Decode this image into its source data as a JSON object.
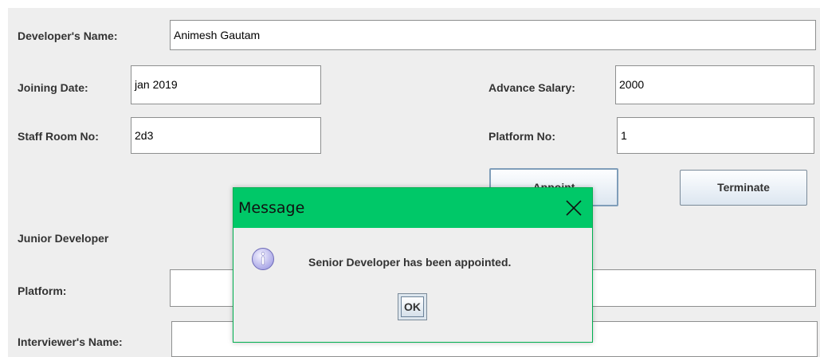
{
  "form": {
    "developer_name_label": "Developer's Name:",
    "developer_name_value": "Animesh Gautam",
    "joining_date_label": "Joining Date:",
    "joining_date_value": "jan 2019",
    "advance_salary_label": "Advance Salary:",
    "advance_salary_value": "2000",
    "staff_room_label": "Staff Room No:",
    "staff_room_value": "2d3",
    "platform_no_label": "Platform No:",
    "platform_no_value": "1",
    "appoint_label": "Appoint",
    "terminate_label": "Terminate",
    "junior_heading": "Junior Developer",
    "platform_label": "Platform:",
    "platform_value": "",
    "interviewer_label": "Interviewer's Name:",
    "interviewer_value": ""
  },
  "dialog": {
    "title": "Message",
    "message": "Senior Developer has been appointed.",
    "ok_label": "OK",
    "icon": "info-icon",
    "close_icon": "close-icon",
    "titlebar_color": "#00c868"
  },
  "colors": {
    "window_bg": "#eeeeee",
    "dialog_titlebar": "#00c868",
    "dialog_border": "#00b050"
  }
}
